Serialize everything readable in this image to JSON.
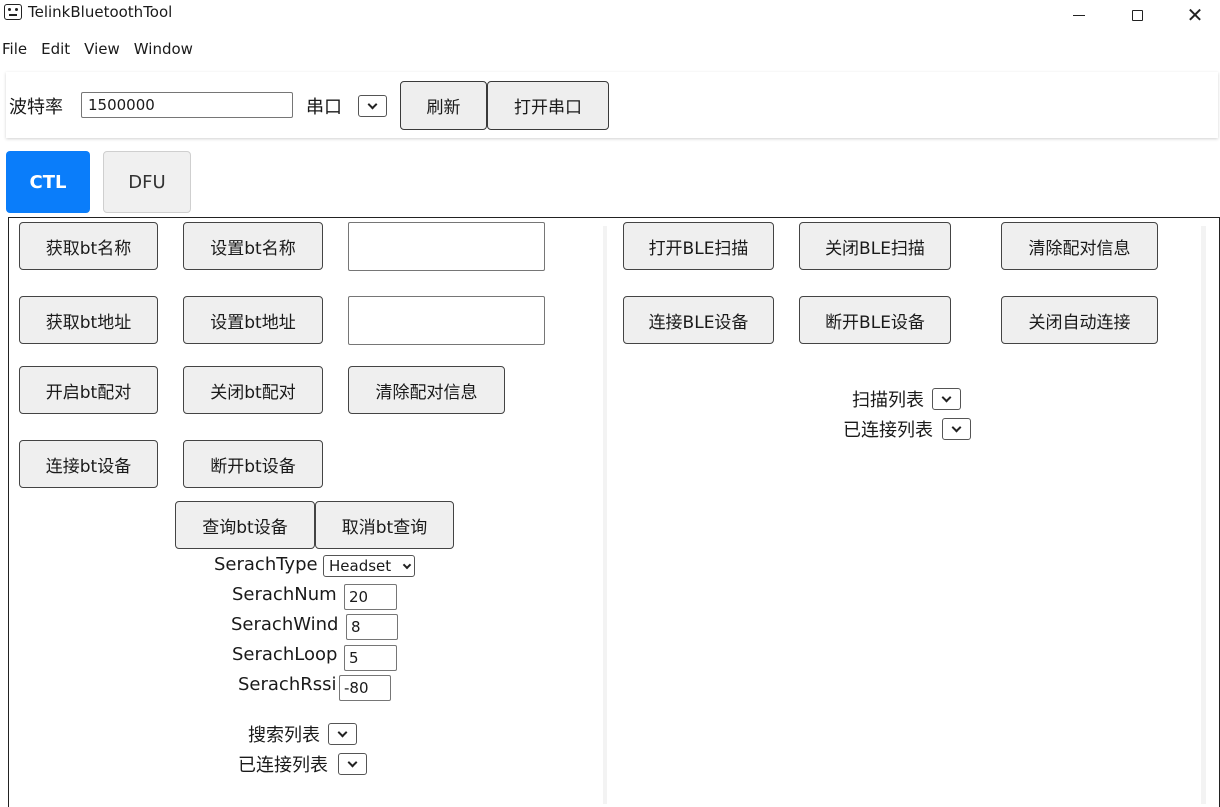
{
  "window": {
    "title": "TelinkBluetoothTool"
  },
  "menu": [
    "File",
    "Edit",
    "View",
    "Window"
  ],
  "toolbar": {
    "baud_label": "波特率",
    "baud_value": "1500000",
    "port_label": "串口",
    "refresh_label": "刷新",
    "open_port_label": "打开串口"
  },
  "tabs": [
    {
      "label": "CTL",
      "active": true
    },
    {
      "label": "DFU",
      "active": false
    }
  ],
  "bt": {
    "get_name": "获取bt名称",
    "set_name": "设置bt名称",
    "name_value": "",
    "get_addr": "获取bt地址",
    "set_addr": "设置bt地址",
    "addr_value": "",
    "open_pair": "开启bt配对",
    "close_pair": "关闭bt配对",
    "clear_pair": "清除配对信息",
    "connect": "连接bt设备",
    "disconnect": "断开bt设备",
    "query": "查询bt设备",
    "cancel_query": "取消bt查询",
    "search_type_label": "SerachType",
    "search_type_value": "Headset",
    "search_num_label": "SerachNum",
    "search_num_value": "20",
    "search_wind_label": "SerachWind",
    "search_wind_value": "8",
    "search_loop_label": "SerachLoop",
    "search_loop_value": "5",
    "search_rssi_label": "SerachRssi",
    "search_rssi_value": "-80",
    "search_list_label": "搜索列表",
    "connected_list_label": "已连接列表"
  },
  "ble": {
    "open_scan": "打开BLE扫描",
    "close_scan": "关闭BLE扫描",
    "clear_pair": "清除配对信息",
    "connect": "连接BLE设备",
    "disconnect": "断开BLE设备",
    "close_auto": "关闭自动连接",
    "scan_list_label": "扫描列表",
    "connected_list_label": "已连接列表"
  }
}
